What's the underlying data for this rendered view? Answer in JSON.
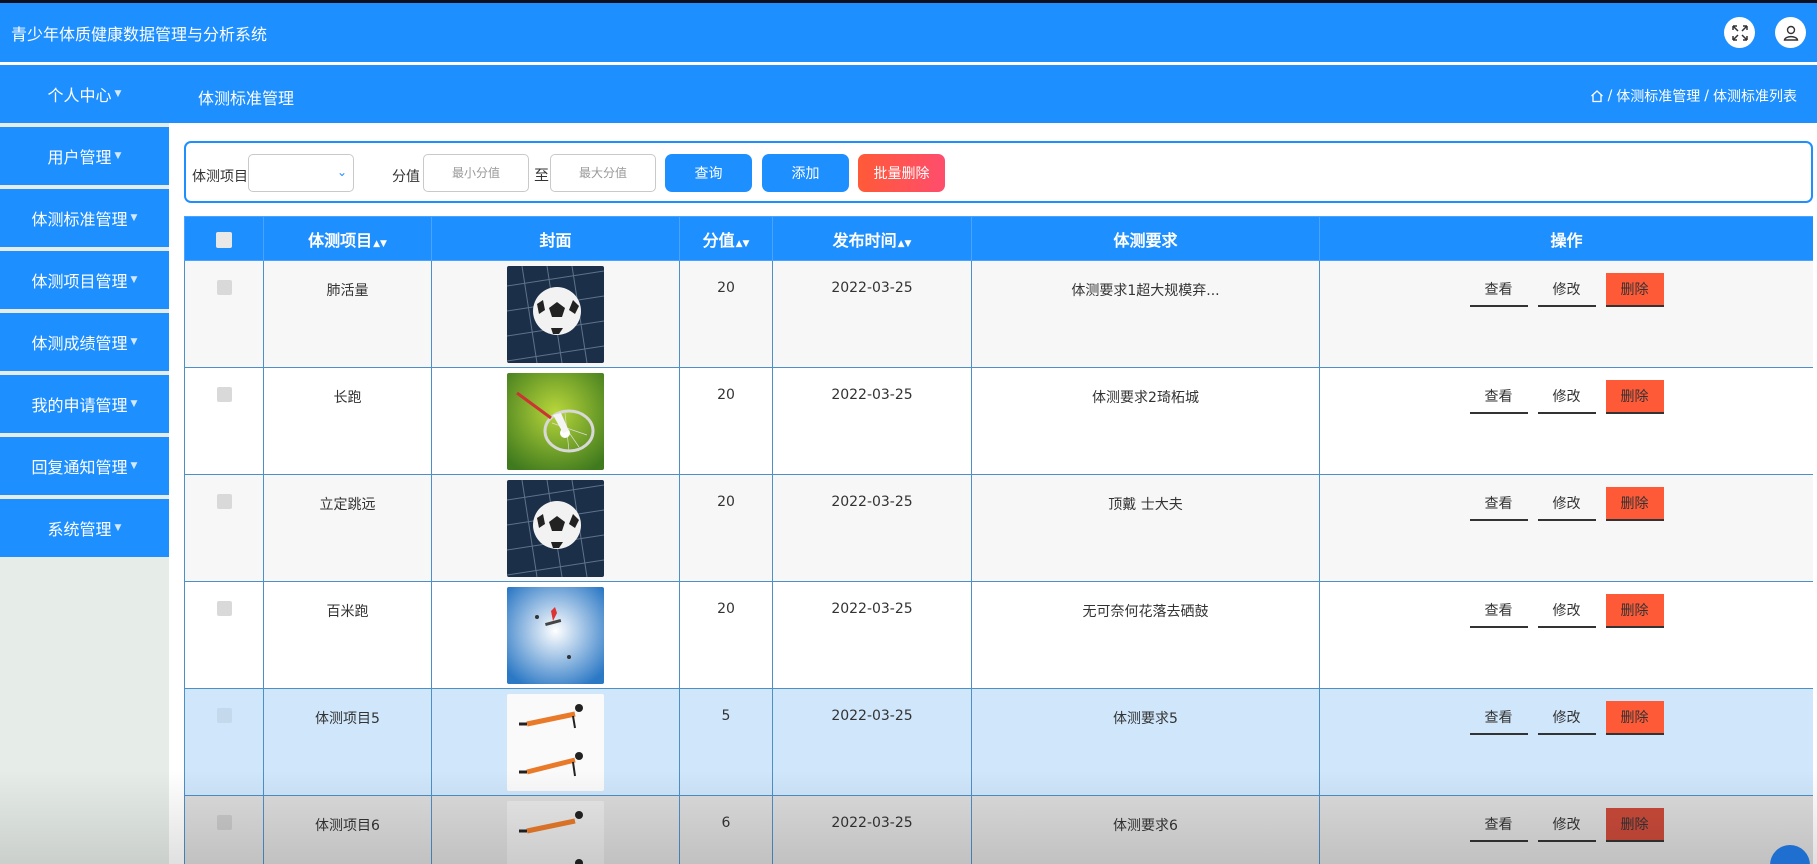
{
  "app": {
    "title": "青少年体质健康数据管理与分析系统"
  },
  "header_icons": [
    "fullscreen-icon",
    "user-icon"
  ],
  "sidebar": {
    "head": "个人中心",
    "items": [
      {
        "label": "用户管理"
      },
      {
        "label": "体测标准管理"
      },
      {
        "label": "体测项目管理"
      },
      {
        "label": "体测成绩管理"
      },
      {
        "label": "我的申请管理"
      },
      {
        "label": "回复通知管理"
      },
      {
        "label": "系统管理"
      }
    ]
  },
  "page": {
    "title": "体测标准管理"
  },
  "breadcrumb": {
    "items": [
      "体测标准管理",
      "体测标准列表"
    ],
    "separator": "/"
  },
  "search": {
    "item_label": "体测项目",
    "item_value": "",
    "score_label": "分值",
    "min_placeholder": "最小分值",
    "to_label": "至",
    "max_placeholder": "最大分值",
    "query_label": "查询",
    "add_label": "添加",
    "batch_delete_label": "批量删除"
  },
  "table": {
    "headers": {
      "item": "体测项目",
      "cover": "封面",
      "score": "分值",
      "time": "发布时间",
      "requirement": "体测要求",
      "actions": "操作"
    },
    "rows": [
      {
        "item": "肺活量",
        "cover": "soccer-ball-in-net",
        "score": "20",
        "time": "2022-03-25",
        "requirement": "体测要求1超大规模弃..."
      },
      {
        "item": "长跑",
        "cover": "badminton-racket-shuttlecock",
        "score": "20",
        "time": "2022-03-25",
        "requirement": "体测要求2琦柘城"
      },
      {
        "item": "立定跳远",
        "cover": "soccer-ball-in-net",
        "score": "20",
        "time": "2022-03-25",
        "requirement": "顶戴 士大夫"
      },
      {
        "item": "百米跑",
        "cover": "snowboarder-jump",
        "score": "20",
        "time": "2022-03-25",
        "requirement": "无可奈何花落去硒鼓"
      },
      {
        "item": "体测项目5",
        "cover": "push-up-exercise",
        "score": "5",
        "time": "2022-03-25",
        "requirement": "体测要求5"
      },
      {
        "item": "体测项目6",
        "cover": "push-up-exercise",
        "score": "6",
        "time": "2022-03-25",
        "requirement": "体测要求6"
      }
    ],
    "action_labels": {
      "view": "查看",
      "edit": "修改",
      "delete": "删除"
    }
  },
  "colors": {
    "primary": "#1e8fff",
    "delete": "#ff5a38",
    "batch_delete_gradient": [
      "#ff5a38",
      "#ff4d6d"
    ],
    "sidebar_bg": "#e6ece8",
    "row_hover": "#cfe6fb"
  }
}
